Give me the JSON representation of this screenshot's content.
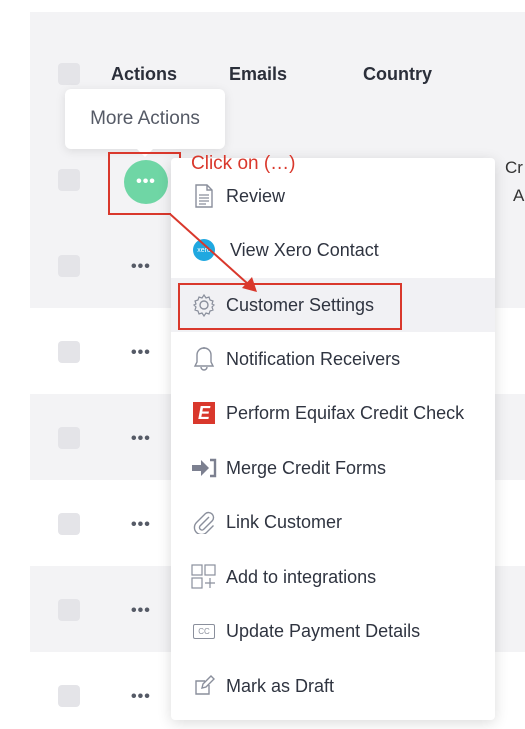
{
  "table": {
    "headers": {
      "actions": "Actions",
      "emails": "Emails",
      "country": "Country"
    },
    "cut_off_texts": [
      "Cr",
      "A"
    ],
    "row_dots_label": "•••"
  },
  "tooltip": {
    "text": "More Actions"
  },
  "action_button": {
    "label": "•••",
    "color": "#6fd6a5"
  },
  "annotation": {
    "text": "Click on (…)",
    "color": "#d9382c"
  },
  "menu": {
    "items": [
      {
        "label": "Review",
        "icon": "document-icon"
      },
      {
        "label": "View Xero Contact",
        "icon": "xero-icon"
      },
      {
        "label": "Customer Settings",
        "icon": "gear-icon",
        "highlighted": true
      },
      {
        "label": "Notification Receivers",
        "icon": "bell-icon"
      },
      {
        "label": "Perform Equifax Credit Check",
        "icon": "equifax-icon"
      },
      {
        "label": "Merge Credit Forms",
        "icon": "merge-icon"
      },
      {
        "label": "Link Customer",
        "icon": "paperclip-icon"
      },
      {
        "label": "Add to integrations",
        "icon": "integrations-icon"
      },
      {
        "label": "Update Payment Details",
        "icon": "credit-card-icon"
      },
      {
        "label": "Mark as Draft",
        "icon": "edit-icon"
      }
    ],
    "xero_icon_text": "xero",
    "equifax_icon_text": "E",
    "card_icon_text": "CC"
  }
}
